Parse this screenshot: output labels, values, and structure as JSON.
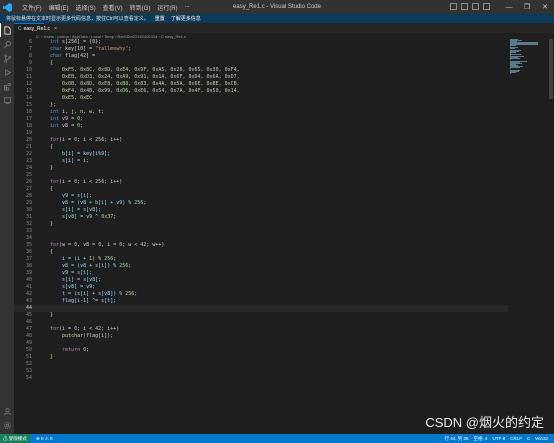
{
  "window": {
    "title": "easy_Re1.c - Visual Studio Code",
    "menu": [
      "文件(F)",
      "编辑(E)",
      "选择(S)",
      "查看(V)",
      "转到(G)",
      "运行(R)",
      "..."
    ],
    "controls": [
      "—",
      "❐",
      "✕"
    ]
  },
  "notice": {
    "text": "将鼠标悬停在文本时显示更多代码信息，按住Ctrl可以查看定义。",
    "link1": "重置",
    "link2": "了解更多信息"
  },
  "tab": {
    "icon": "C",
    "label": "easy_Re1.c",
    "close": "×"
  },
  "breadcrumb": "C: › Users › pohua › AppData › Local › Temp › RarSDrv22152402414 › C easy_Re1.c",
  "editor": {
    "current_line": "44",
    "lines": [
      {
        "n": "6",
        "t": [
          [
            "int",
            "kw"
          ],
          [
            " s[256] = {0};",
            "pl"
          ]
        ]
      },
      {
        "n": "7",
        "t": [
          [
            "char",
            "kw"
          ],
          [
            " key[10] = ",
            "pl"
          ],
          [
            "\"tallmewhy\"",
            "str"
          ],
          [
            ";",
            "pl"
          ]
        ]
      },
      {
        "n": "8",
        "t": [
          [
            "char",
            "kw"
          ],
          [
            " flag[42] =",
            "pl"
          ]
        ]
      },
      {
        "n": "9",
        "t": [
          [
            "{",
            "pl"
          ]
        ]
      },
      {
        "n": "10",
        "t": [
          [
            "    0xF5, 0x8C, 0x8D, 0xE4, 0x9F, 0xA5, 0x28, 0x65, 0x30, 0xF4,",
            "num"
          ]
        ]
      },
      {
        "n": "11",
        "t": [
          [
            "    0xEB, 0xD3, 0x24, 0xA9, 0x91, 0x1A, 0x6F, 0xD4, 0x6A, 0xD7,",
            "num"
          ]
        ]
      },
      {
        "n": "12",
        "t": [
          [
            "    0x0B, 0x8D, 0xE8, 0xB8, 0x83, 0x4A, 0x5A, 0x6E, 0xBE, 0xCB,",
            "num"
          ]
        ]
      },
      {
        "n": "13",
        "t": [
          [
            "    0xF4, 0x4B, 0x99, 0xD6, 0xE6, 0x54, 0x7A, 0x4F, 0x50, 0x14,",
            "num"
          ]
        ]
      },
      {
        "n": "14",
        "t": [
          [
            "    0xE5, 0xEC",
            "num"
          ]
        ]
      },
      {
        "n": "15",
        "t": [
          [
            "};",
            "pl"
          ]
        ]
      },
      {
        "n": "16",
        "t": [
          [
            "int",
            "kw"
          ],
          [
            " i, j, n, w, t;",
            "pl"
          ]
        ]
      },
      {
        "n": "17",
        "t": [
          [
            "int",
            "kw"
          ],
          [
            " v9 = ",
            "pl"
          ],
          [
            "0",
            "num"
          ],
          [
            ";",
            "pl"
          ]
        ]
      },
      {
        "n": "18",
        "t": [
          [
            "int",
            "kw"
          ],
          [
            " v8 = ",
            "pl"
          ],
          [
            "0",
            "num"
          ],
          [
            ";",
            "pl"
          ]
        ]
      },
      {
        "n": "19",
        "t": []
      },
      {
        "n": "20",
        "t": [
          [
            "for",
            "ctl"
          ],
          [
            "(i = ",
            "pl"
          ],
          [
            "0",
            "num"
          ],
          [
            "; i < ",
            "pl"
          ],
          [
            "256",
            "num"
          ],
          [
            "; i++)",
            "pl"
          ]
        ]
      },
      {
        "n": "21",
        "t": [
          [
            "{",
            "pl"
          ]
        ]
      },
      {
        "n": "22",
        "t": [
          [
            "    b[i] = key[i%9];",
            "var"
          ]
        ]
      },
      {
        "n": "23",
        "t": [
          [
            "    s[i] = i;",
            "var"
          ]
        ]
      },
      {
        "n": "24",
        "t": [
          [
            "}",
            "pl"
          ]
        ]
      },
      {
        "n": "25",
        "t": []
      },
      {
        "n": "26",
        "t": [
          [
            "for",
            "ctl"
          ],
          [
            "(i = ",
            "pl"
          ],
          [
            "0",
            "num"
          ],
          [
            "; i < ",
            "pl"
          ],
          [
            "256",
            "num"
          ],
          [
            "; i++)",
            "pl"
          ]
        ]
      },
      {
        "n": "27",
        "t": [
          [
            "{",
            "pl"
          ]
        ]
      },
      {
        "n": "28",
        "t": [
          [
            "    v9 = s[i];",
            "var"
          ]
        ]
      },
      {
        "n": "29",
        "t": [
          [
            "    v8 = (v8 + b[i] + v9) % ",
            "var"
          ],
          [
            "256",
            "num"
          ],
          [
            ";",
            "pl"
          ]
        ]
      },
      {
        "n": "30",
        "t": [
          [
            "    s[i] = s[v8];",
            "var"
          ]
        ]
      },
      {
        "n": "31",
        "t": [
          [
            "    s[v8] = v9 ^ ",
            "var"
          ],
          [
            "0x37",
            "num"
          ],
          [
            ";",
            "pl"
          ]
        ]
      },
      {
        "n": "32",
        "t": [
          [
            "}",
            "pl"
          ]
        ]
      },
      {
        "n": "33",
        "t": []
      },
      {
        "n": "34",
        "t": []
      },
      {
        "n": "35",
        "t": [
          [
            "for",
            "ctl"
          ],
          [
            "(w = ",
            "pl"
          ],
          [
            "0",
            "num"
          ],
          [
            ", v8 = ",
            "pl"
          ],
          [
            "0",
            "num"
          ],
          [
            ", i = ",
            "pl"
          ],
          [
            "0",
            "num"
          ],
          [
            "; w < ",
            "pl"
          ],
          [
            "42",
            "num"
          ],
          [
            "; w++)",
            "pl"
          ]
        ]
      },
      {
        "n": "36",
        "t": [
          [
            "{",
            "pl"
          ]
        ]
      },
      {
        "n": "37",
        "t": [
          [
            "    i = (i + ",
            "var"
          ],
          [
            "1",
            "num"
          ],
          [
            ") % ",
            "pl"
          ],
          [
            "256",
            "num"
          ],
          [
            ";",
            "pl"
          ]
        ]
      },
      {
        "n": "38",
        "t": [
          [
            "    v8 = (v8 + s[i]) % ",
            "var"
          ],
          [
            "256",
            "num"
          ],
          [
            ";",
            "pl"
          ]
        ]
      },
      {
        "n": "39",
        "t": [
          [
            "    v9 = s[i];",
            "var"
          ]
        ]
      },
      {
        "n": "40",
        "t": [
          [
            "    s[i] = s[v8];",
            "var"
          ]
        ]
      },
      {
        "n": "41",
        "t": [
          [
            "    s[v8] = v9;",
            "var"
          ]
        ]
      },
      {
        "n": "42",
        "t": [
          [
            "    t = (s[i] + s[v8]) % ",
            "var"
          ],
          [
            "256",
            "num"
          ],
          [
            ";",
            "pl"
          ]
        ]
      },
      {
        "n": "43",
        "t": [
          [
            "    flag[i-1] ^= s[t];",
            "var"
          ]
        ]
      },
      {
        "n": "44",
        "t": []
      },
      {
        "n": "45",
        "t": [
          [
            "}",
            "pl"
          ]
        ]
      },
      {
        "n": "46",
        "t": []
      },
      {
        "n": "47",
        "t": [
          [
            "for",
            "ctl"
          ],
          [
            "(i = ",
            "pl"
          ],
          [
            "0",
            "num"
          ],
          [
            "; i < ",
            "pl"
          ],
          [
            "42",
            "num"
          ],
          [
            "; i++)",
            "pl"
          ]
        ]
      },
      {
        "n": "48",
        "t": [
          [
            "    ",
            "pl"
          ],
          [
            "putchar",
            "fn"
          ],
          [
            "(flag[i]);",
            "pl"
          ]
        ]
      },
      {
        "n": "49",
        "t": []
      },
      {
        "n": "50",
        "t": [
          [
            "    ",
            "pl"
          ],
          [
            "return",
            "ctl"
          ],
          [
            " ",
            "pl"
          ],
          [
            "0",
            "num"
          ],
          [
            ";",
            "pl"
          ]
        ]
      },
      {
        "n": "51",
        "t": [
          [
            "}",
            "brk"
          ]
        ]
      },
      {
        "n": "52",
        "t": []
      },
      {
        "n": "53",
        "t": []
      },
      {
        "n": "54",
        "t": []
      }
    ]
  },
  "status": {
    "remote": "⚠ 受限模式",
    "errors": "⊗ 0 ⚠ 0",
    "position": "行 44, 列 26",
    "spaces": "空格: 4",
    "encoding": "UTF-8",
    "eol": "CRLF",
    "language": "C",
    "platform": "Win32"
  },
  "watermark": "CSDN @烟火的约定",
  "colors": {
    "accent": "#007acc",
    "editor_bg": "#1e1e1e",
    "activity_bg": "#333333",
    "title_bg": "#323233"
  }
}
